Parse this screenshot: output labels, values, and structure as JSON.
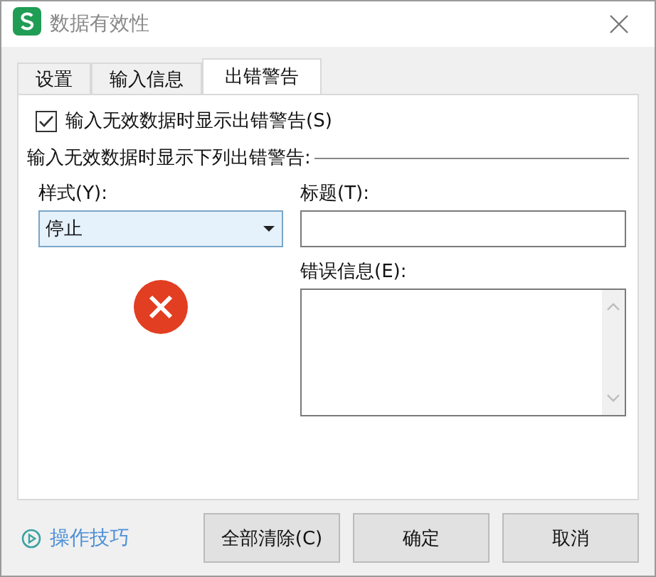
{
  "window": {
    "title": "数据有效性"
  },
  "tabs": [
    {
      "label": "设置",
      "selected": false
    },
    {
      "label": "输入信息",
      "selected": false
    },
    {
      "label": "出错警告",
      "selected": true
    }
  ],
  "show_alert": {
    "label": "输入无效数据时显示出错警告(S)",
    "checked": true
  },
  "group_label": "输入无效数据时显示下列出错警告:",
  "style": {
    "label": "样式(Y):",
    "value": "停止"
  },
  "title_field": {
    "label": "标题(T):"
  },
  "message_field": {
    "label": "错误信息(E):"
  },
  "tips_link": "操作技巧",
  "buttons": [
    "全部清除(C)",
    "确定",
    "取消"
  ]
}
